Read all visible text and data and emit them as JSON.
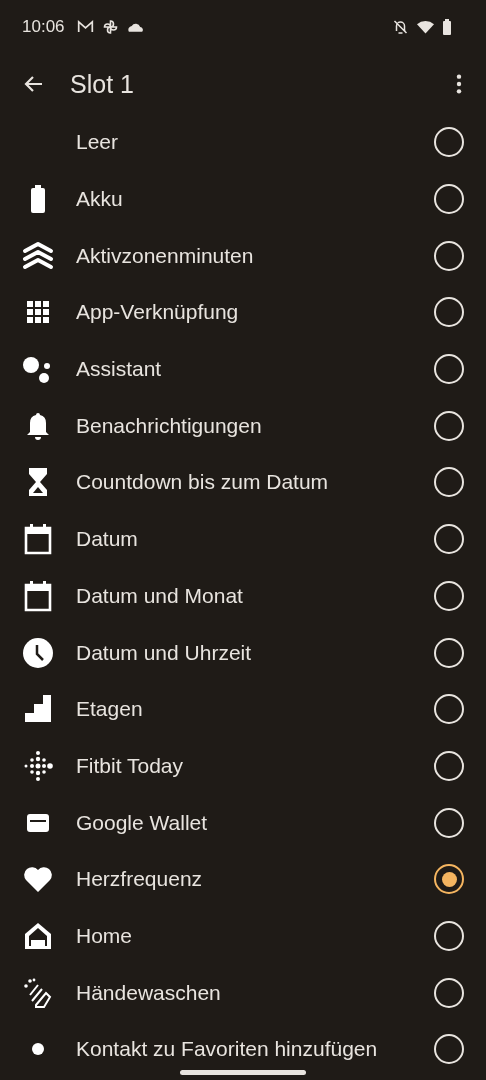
{
  "status_bar": {
    "time": "10:06"
  },
  "app_bar": {
    "title": "Slot 1"
  },
  "options": [
    {
      "label": "Leer",
      "selected": false
    },
    {
      "label": "Akku",
      "selected": false
    },
    {
      "label": "Aktivzonenminuten",
      "selected": false
    },
    {
      "label": "App-Verknüpfung",
      "selected": false
    },
    {
      "label": "Assistant",
      "selected": false
    },
    {
      "label": "Benachrichtigungen",
      "selected": false
    },
    {
      "label": "Countdown bis zum Datum",
      "selected": false
    },
    {
      "label": "Datum",
      "selected": false
    },
    {
      "label": "Datum und Monat",
      "selected": false
    },
    {
      "label": "Datum und Uhrzeit",
      "selected": false
    },
    {
      "label": "Etagen",
      "selected": false
    },
    {
      "label": "Fitbit Today",
      "selected": false
    },
    {
      "label": "Google Wallet",
      "selected": false
    },
    {
      "label": "Herzfrequenz",
      "selected": true
    },
    {
      "label": "Home",
      "selected": false
    },
    {
      "label": "Händewaschen",
      "selected": false
    },
    {
      "label": "Kontakt zu Favoriten hinzufügen",
      "selected": false
    }
  ]
}
